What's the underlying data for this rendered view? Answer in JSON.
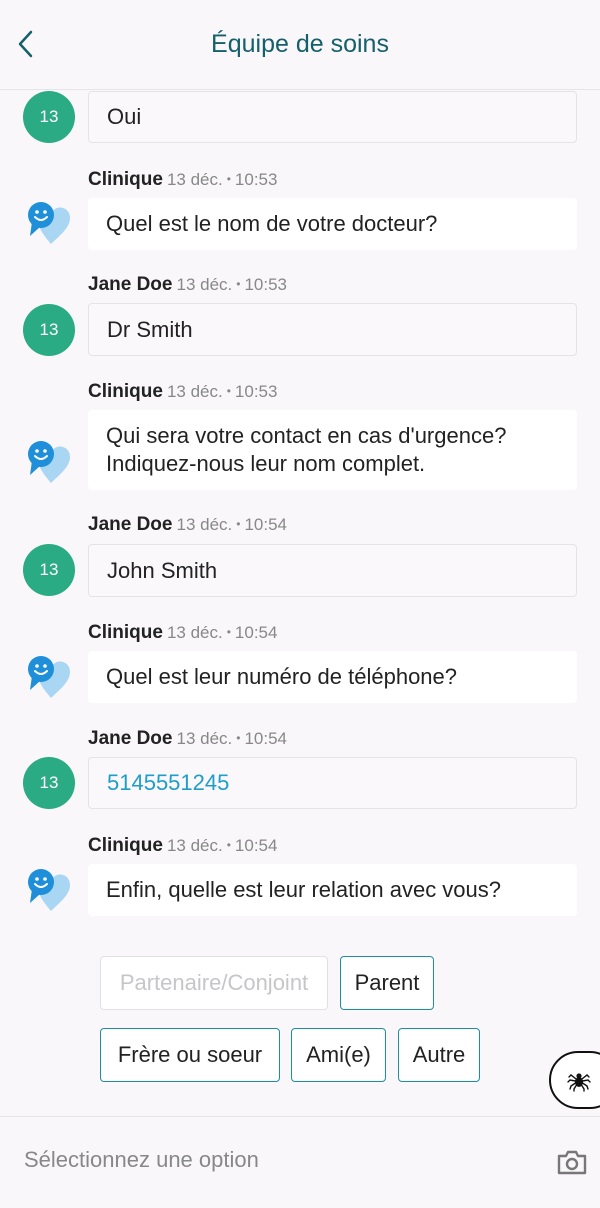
{
  "header": {
    "title": "Équipe de soins",
    "back_icon": "chevron-left-icon"
  },
  "avatar_label": "13",
  "colors": {
    "accent": "#15606b",
    "avatar": "#2bab83",
    "link": "#1f9ec9",
    "button_border": "#1c8ea0"
  },
  "messages": [
    {
      "sender": "",
      "time": "",
      "text": "Oui",
      "type": "user"
    },
    {
      "sender": "Clinique",
      "time": "13 déc.",
      "clock": "10:53",
      "text": "Quel est le nom de votre docteur?",
      "type": "clinic"
    },
    {
      "sender": "Jane Doe",
      "time": "13 déc.",
      "clock": "10:53",
      "text": "Dr Smith",
      "type": "user"
    },
    {
      "sender": "Clinique",
      "time": "13 déc.",
      "clock": "10:53",
      "text_line1": "Qui sera votre contact en cas d'urgence?",
      "text_line2": "Indiquez-nous leur nom complet.",
      "type": "clinic"
    },
    {
      "sender": "Jane Doe",
      "time": "13 déc.",
      "clock": "10:54",
      "text": "John Smith",
      "type": "user"
    },
    {
      "sender": "Clinique",
      "time": "13 déc.",
      "clock": "10:54",
      "text": "Quel est leur numéro de téléphone?",
      "type": "clinic"
    },
    {
      "sender": "Jane Doe",
      "time": "13 déc.",
      "clock": "10:54",
      "text": "5145551245",
      "type": "user"
    },
    {
      "sender": "Clinique",
      "time": "13 déc.",
      "clock": "10:54",
      "text": "Enfin, quelle est leur relation avec vous?",
      "type": "clinic"
    }
  ],
  "options": [
    {
      "label": "Partenaire/Conjoint",
      "disabled": true
    },
    {
      "label": "Parent",
      "disabled": false
    },
    {
      "label": "Frère ou soeur",
      "disabled": false
    },
    {
      "label": "Ami(e)",
      "disabled": false
    },
    {
      "label": "Autre",
      "disabled": false
    }
  ],
  "input": {
    "placeholder": "Sélectionnez une option",
    "icon": "camera-icon"
  },
  "debug_icon": "spider-icon"
}
